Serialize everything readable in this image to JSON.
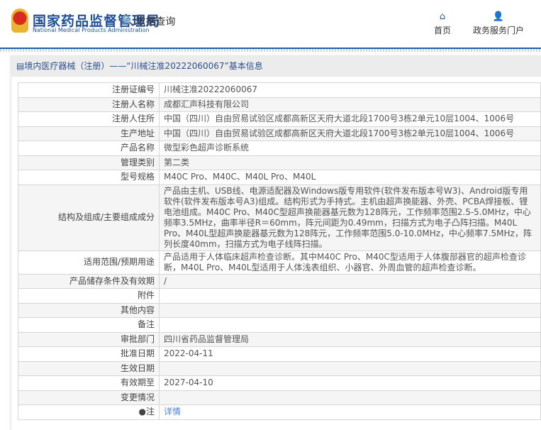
{
  "header": {
    "logo_cn": "国家药品监督管理局",
    "logo_en": "National Medical Products Administration",
    "data_query": "数据查询",
    "nav": [
      {
        "label": "首页",
        "icon": "home-icon"
      },
      {
        "label": "政务服务门户",
        "icon": "user-icon"
      }
    ]
  },
  "title": "境内医疗器械（注册）——“川械注准20222060067”基本信息",
  "rows": [
    {
      "label": "注册证编号",
      "value": "川械注准20222060067"
    },
    {
      "label": "注册人名称",
      "value": "成都汇声科技有限公司"
    },
    {
      "label": "注册人住所",
      "value": "中国（四川）自由贸易试验区成都高新区天府大道北段1700号3栋2单元10层1004、1006号"
    },
    {
      "label": "生产地址",
      "value": "中国（四川）自由贸易试验区成都高新区天府大道北段1700号3栋2单元10层1004、1006号"
    },
    {
      "label": "产品名称",
      "value": "微型彩色超声诊断系统"
    },
    {
      "label": "管理类别",
      "value": "第二类"
    },
    {
      "label": "型号规格",
      "value": "M40C Pro、M40C、M40L Pro、M40L"
    },
    {
      "label": "结构及组成/主要组成成分",
      "value": "产品由主机、USB线、电源适配器及Windows版专用软件(软件发布版本号W3)、Android版专用软件(软件发布版本号A3)组成。结构形式为手持式。主机由超声换能器、外壳、PCBA焊接板、锂电池组成。M40C Pro、M40C型超声换能器基元数为128阵元，工作频率范围2.5-5.0MHz，中心频率3.5MHz，曲率半径R＝60mm，阵元间距为0.49mm，扫描方式为电子凸阵扫描。M40L Pro、M40L型超声换能器基元数为128阵元，工作频率范围5.0-10.0MHz，中心频率7.5MHz，阵列长度40mm，扫描方式为电子线阵扫描。"
    },
    {
      "label": "适用范围/预期用途",
      "value": "产品适用于人体临床超声检查诊断。其中M40C Pro、M40C型适用于人体腹部器官的超声检查诊断，M40L Pro、M40L型适用于人体浅表组织、小器官、外周血管的超声检查诊断。"
    },
    {
      "label": "产品储存条件及有效期",
      "value": "/"
    },
    {
      "label": "附件",
      "value": ""
    },
    {
      "label": "其他内容",
      "value": ""
    },
    {
      "label": "备注",
      "value": ""
    },
    {
      "label": "审批部门",
      "value": "四川省药品监督管理局"
    },
    {
      "label": "批准日期",
      "value": "2022-04-11"
    },
    {
      "label": "生效日期",
      "value": ""
    },
    {
      "label": "有效期至",
      "value": "2027-04-10"
    },
    {
      "label": "变更情况",
      "value": ""
    }
  ],
  "note": {
    "label": "注",
    "link": "详情"
  }
}
